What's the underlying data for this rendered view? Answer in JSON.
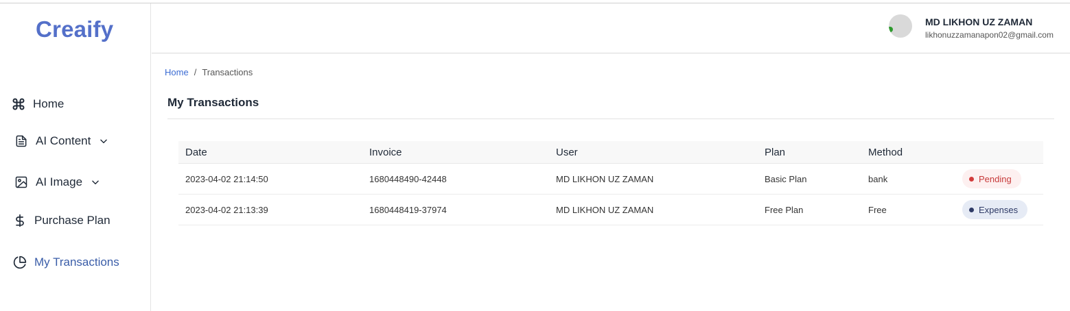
{
  "app": {
    "logo": "Creaify"
  },
  "sidebar": {
    "items": [
      {
        "label": "Home",
        "icon": "command-icon"
      },
      {
        "label": "AI Content",
        "icon": "document-icon",
        "expandable": true
      },
      {
        "label": "AI Image",
        "icon": "image-icon",
        "expandable": true
      },
      {
        "label": "Purchase Plan",
        "icon": "dollar-icon"
      },
      {
        "label": "My Transactions",
        "icon": "pie-chart-icon",
        "active": true
      }
    ]
  },
  "header": {
    "user_name": "MD LIKHON UZ ZAMAN",
    "user_email": "likhonuzzamanapon02@gmail.com"
  },
  "breadcrumb": {
    "home": "Home",
    "separator": "/",
    "current": "Transactions"
  },
  "page": {
    "title": "My Transactions"
  },
  "table": {
    "columns": [
      "Date",
      "Invoice",
      "User",
      "Plan",
      "Method",
      ""
    ],
    "rows": [
      {
        "date": "2023-04-02 21:14:50",
        "invoice": "1680448490-42448",
        "user": "MD LIKHON UZ ZAMAN",
        "plan": "Basic Plan",
        "method": "bank",
        "status": "Pending"
      },
      {
        "date": "2023-04-02 21:13:39",
        "invoice": "1680448419-37974",
        "user": "MD LIKHON UZ ZAMAN",
        "plan": "Free Plan",
        "method": "Free",
        "status": "Expenses"
      }
    ]
  },
  "colors": {
    "brand": "#5470c9",
    "active_nav": "#3a5da8",
    "link": "#3a6bd3",
    "pending": "#d23b3b",
    "expenses": "#2e3a66"
  }
}
